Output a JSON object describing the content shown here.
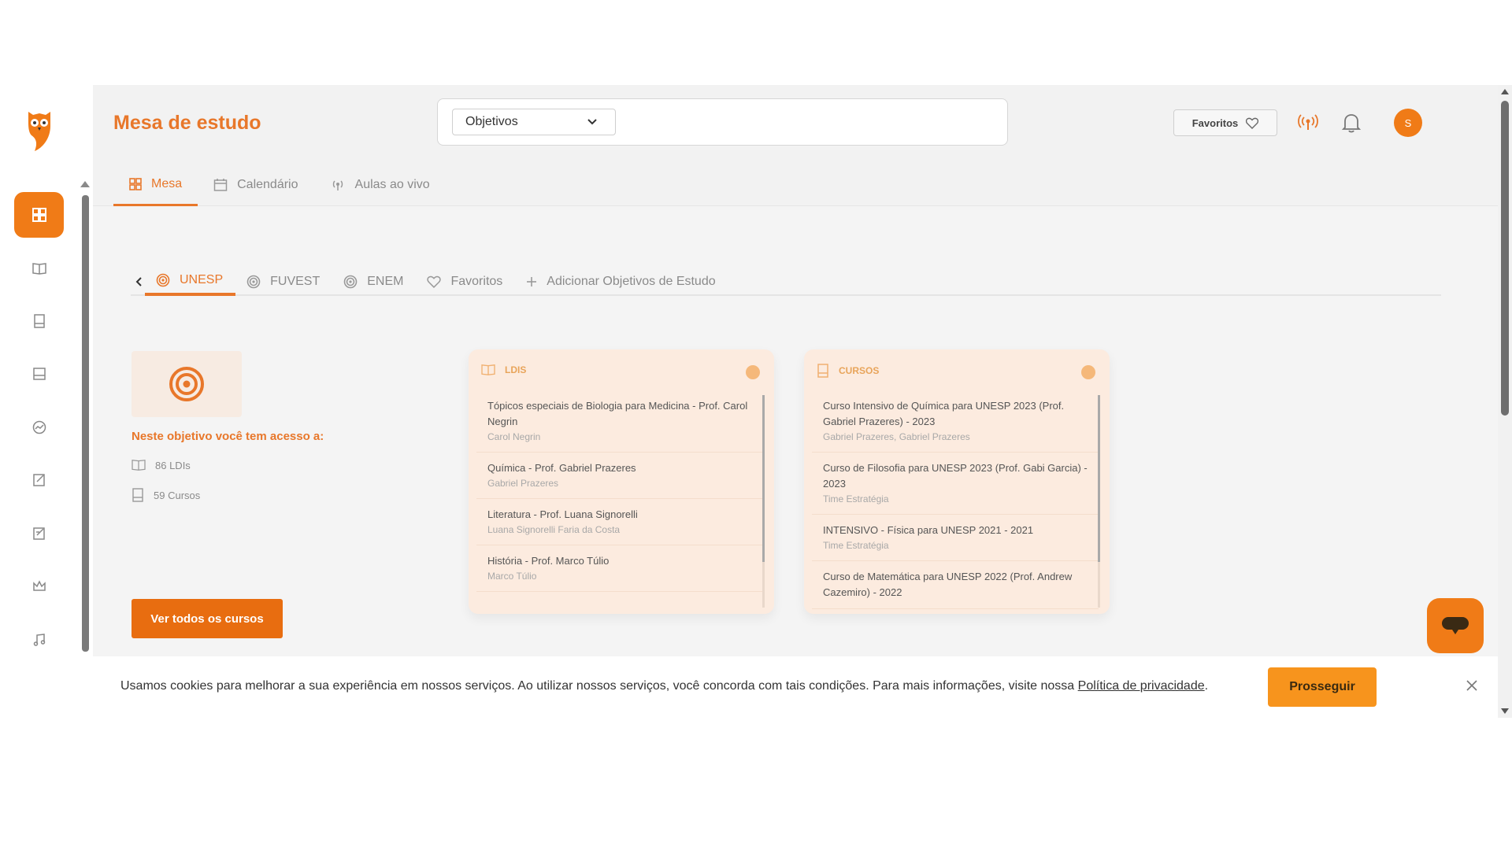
{
  "header": {
    "title": "Mesa de estudo",
    "select_value": "Objetivos",
    "favorites_label": "Favoritos",
    "avatar_initial": "S"
  },
  "tabs": [
    {
      "label": "Mesa",
      "icon": "grid-icon",
      "active": true
    },
    {
      "label": "Calendário",
      "icon": "calendar-icon"
    },
    {
      "label": "Aulas ao vivo",
      "icon": "broadcast-icon"
    }
  ],
  "objective_tabs": [
    {
      "label": "UNESP",
      "icon": "target-icon",
      "active": true
    },
    {
      "label": "FUVEST",
      "icon": "target-icon"
    },
    {
      "label": "ENEM",
      "icon": "target-icon"
    },
    {
      "label": "Favoritos",
      "icon": "heart-icon"
    },
    {
      "label": "Adicionar Objetivos de Estudo",
      "icon": "plus-icon"
    }
  ],
  "objective": {
    "access_title": "Neste objetivo você tem acesso a:",
    "ldis_count": "86 LDIs",
    "cursos_count": "59 Cursos",
    "cta_label": "Ver todos os cursos"
  },
  "ldis_card": {
    "title": "LDIS",
    "items": [
      {
        "title": "Tópicos especiais de Biologia para Medicina - Prof. Carol Negrin",
        "sub": "Carol Negrin"
      },
      {
        "title": "Química - Prof. Gabriel Prazeres",
        "sub": "Gabriel Prazeres"
      },
      {
        "title": "Literatura - Prof. Luana Signorelli",
        "sub": "Luana Signorelli Faria da Costa"
      },
      {
        "title": "História - Prof. Marco Túlio",
        "sub": "Marco Túlio"
      }
    ]
  },
  "cursos_card": {
    "title": "CURSOS",
    "items": [
      {
        "title": "Curso Intensivo de Química para UNESP 2023 (Prof. Gabriel Prazeres) - 2023",
        "sub": "Gabriel Prazeres, Gabriel Prazeres"
      },
      {
        "title": "Curso de Filosofia para UNESP 2023 (Prof. Gabi Garcia) - 2023",
        "sub": "Time Estratégia"
      },
      {
        "title": "INTENSIVO - Física para UNESP 2021 - 2021",
        "sub": "Time Estratégia"
      },
      {
        "title": "Curso de Matemática para UNESP 2022 (Prof. Andrew Cazemiro) - 2022",
        "sub": ""
      }
    ]
  },
  "cookie": {
    "text": "Usamos cookies para melhorar a sua experiência em nossos serviços. Ao utilizar nossos serviços, você concorda com tais condições. Para mais informações, visite nossa ",
    "link": "Política de privacidade",
    "after": ".",
    "button": "Prosseguir"
  },
  "sidebar_icons": [
    "dashboard-icon",
    "book-open-icon",
    "notebook-icon",
    "document-icon",
    "chart-icon",
    "edit-icon",
    "edit-list-icon",
    "crown-icon",
    "music-icon"
  ],
  "colors": {
    "accent": "#e8772a",
    "button": "#e86d10",
    "cookie_button": "#f7941d"
  }
}
